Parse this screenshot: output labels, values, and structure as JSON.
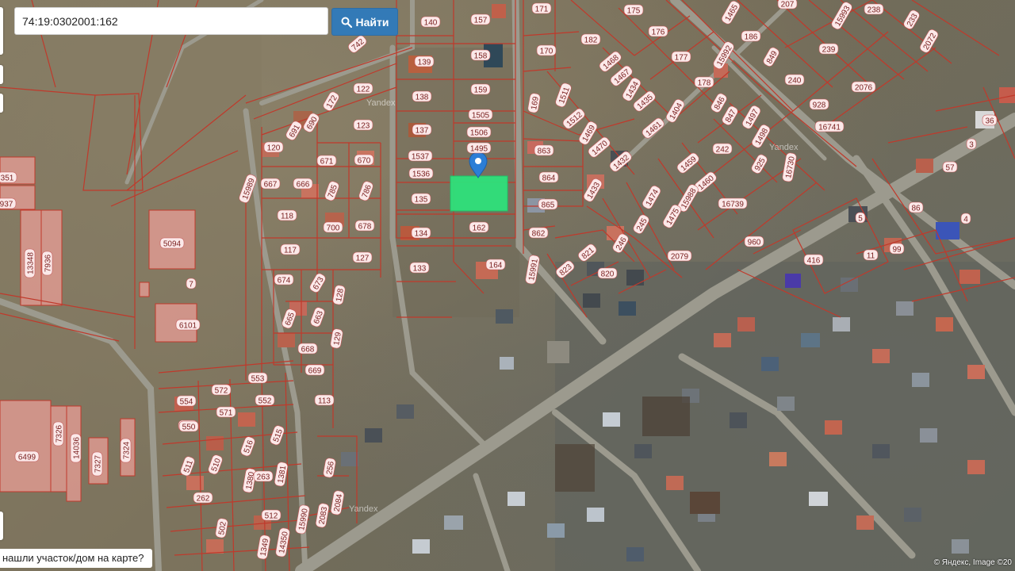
{
  "search": {
    "query": "74:19:0302001:162",
    "button_label": "Найти",
    "button_icon": "search-icon"
  },
  "help": {
    "text": "нашли участок/дом на карте?"
  },
  "copyright": "© Яндекс, Image ©20",
  "watermark": "Yandex",
  "map": {
    "type": "satellite-cadastral",
    "parcel_border_color": "#c0392b",
    "highlight_color": "#2ee07a",
    "marker_color": "#2c7ed6",
    "selected_parcel": "162",
    "parcels": [
      {
        "id": "140",
        "label": "140"
      },
      {
        "id": "157",
        "label": "157"
      },
      {
        "id": "171",
        "label": "171"
      },
      {
        "id": "175",
        "label": "175"
      },
      {
        "id": "1465",
        "label": "1465"
      },
      {
        "id": "207",
        "label": "207"
      },
      {
        "id": "15993",
        "label": "15993"
      },
      {
        "id": "238",
        "label": "238"
      },
      {
        "id": "233",
        "label": "233"
      },
      {
        "id": "742",
        "label": "742"
      },
      {
        "id": "139",
        "label": "139"
      },
      {
        "id": "158",
        "label": "158"
      },
      {
        "id": "170",
        "label": "170"
      },
      {
        "id": "182",
        "label": "182"
      },
      {
        "id": "176",
        "label": "176"
      },
      {
        "id": "186",
        "label": "186"
      },
      {
        "id": "849",
        "label": "849"
      },
      {
        "id": "239",
        "label": "239"
      },
      {
        "id": "2072",
        "label": "2072"
      },
      {
        "id": "15992",
        "label": "15992"
      },
      {
        "id": "122",
        "label": "122"
      },
      {
        "id": "138",
        "label": "138"
      },
      {
        "id": "159",
        "label": "159"
      },
      {
        "id": "1511",
        "label": "1511"
      },
      {
        "id": "1468",
        "label": "1468"
      },
      {
        "id": "177",
        "label": "177"
      },
      {
        "id": "240",
        "label": "240"
      },
      {
        "id": "2076",
        "label": "2076"
      },
      {
        "id": "172",
        "label": "172"
      },
      {
        "id": "1467",
        "label": "1467"
      },
      {
        "id": "1434",
        "label": "1434"
      },
      {
        "id": "178",
        "label": "178"
      },
      {
        "id": "928",
        "label": "928"
      },
      {
        "id": "169",
        "label": "169"
      },
      {
        "id": "1435",
        "label": "1435"
      },
      {
        "id": "846",
        "label": "846"
      },
      {
        "id": "690",
        "label": "690"
      },
      {
        "id": "123",
        "label": "123"
      },
      {
        "id": "137",
        "label": "137"
      },
      {
        "id": "1505",
        "label": "1505"
      },
      {
        "id": "1512",
        "label": "1512"
      },
      {
        "id": "1404",
        "label": "1404"
      },
      {
        "id": "847",
        "label": "847"
      },
      {
        "id": "1497",
        "label": "1497"
      },
      {
        "id": "16741",
        "label": "16741"
      },
      {
        "id": "691",
        "label": "691"
      },
      {
        "id": "1506",
        "label": "1506"
      },
      {
        "id": "1469",
        "label": "1469"
      },
      {
        "id": "1461",
        "label": "1461"
      },
      {
        "id": "1498",
        "label": "1498"
      },
      {
        "id": "120",
        "label": "120"
      },
      {
        "id": "1495",
        "label": "1495"
      },
      {
        "id": "863",
        "label": "863"
      },
      {
        "id": "1470",
        "label": "1470"
      },
      {
        "id": "242",
        "label": "242"
      },
      {
        "id": "671",
        "label": "671"
      },
      {
        "id": "670",
        "label": "670"
      },
      {
        "id": "1537",
        "label": "1537"
      },
      {
        "id": "1432",
        "label": "1432"
      },
      {
        "id": "1459",
        "label": "1459"
      },
      {
        "id": "925",
        "label": "925"
      },
      {
        "id": "16730",
        "label": "16730"
      },
      {
        "id": "667",
        "label": "667"
      },
      {
        "id": "666",
        "label": "666"
      },
      {
        "id": "1536",
        "label": "1536"
      },
      {
        "id": "864",
        "label": "864"
      },
      {
        "id": "1460",
        "label": "1460"
      },
      {
        "id": "15989",
        "label": "15989"
      },
      {
        "id": "785",
        "label": "785"
      },
      {
        "id": "786",
        "label": "786"
      },
      {
        "id": "135",
        "label": "135"
      },
      {
        "id": "1433",
        "label": "1433"
      },
      {
        "id": "1474",
        "label": "1474"
      },
      {
        "id": "15988",
        "label": "15988"
      },
      {
        "id": "16739",
        "label": "16739"
      },
      {
        "id": "865",
        "label": "865"
      },
      {
        "id": "118",
        "label": "118"
      },
      {
        "id": "700",
        "label": "700"
      },
      {
        "id": "678",
        "label": "678"
      },
      {
        "id": "1475",
        "label": "1475"
      },
      {
        "id": "245",
        "label": "245"
      },
      {
        "id": "134",
        "label": "134"
      },
      {
        "id": "162",
        "label": "162"
      },
      {
        "id": "862",
        "label": "862"
      },
      {
        "id": "246",
        "label": "246"
      },
      {
        "id": "960",
        "label": "960"
      },
      {
        "id": "117",
        "label": "117"
      },
      {
        "id": "127",
        "label": "127"
      },
      {
        "id": "821",
        "label": "821"
      },
      {
        "id": "2079",
        "label": "2079"
      },
      {
        "id": "133",
        "label": "133"
      },
      {
        "id": "164",
        "label": "164"
      },
      {
        "id": "15991",
        "label": "15991"
      },
      {
        "id": "823",
        "label": "823"
      },
      {
        "id": "820",
        "label": "820"
      },
      {
        "id": "674",
        "label": "674"
      },
      {
        "id": "673",
        "label": "673"
      },
      {
        "id": "128",
        "label": "128"
      },
      {
        "id": "663",
        "label": "663"
      },
      {
        "id": "665",
        "label": "665"
      },
      {
        "id": "129",
        "label": "129"
      },
      {
        "id": "668",
        "label": "668"
      },
      {
        "id": "669",
        "label": "669"
      },
      {
        "id": "553",
        "label": "553"
      },
      {
        "id": "552",
        "label": "552"
      },
      {
        "id": "113",
        "label": "113"
      },
      {
        "id": "554",
        "label": "554"
      },
      {
        "id": "572",
        "label": "572"
      },
      {
        "id": "551",
        "label": "551"
      },
      {
        "id": "571",
        "label": "571"
      },
      {
        "id": "550",
        "label": "550"
      },
      {
        "id": "515",
        "label": "515"
      },
      {
        "id": "516",
        "label": "516"
      },
      {
        "id": "511",
        "label": "511"
      },
      {
        "id": "510",
        "label": "510"
      },
      {
        "id": "1380",
        "label": "1380"
      },
      {
        "id": "263",
        "label": "263"
      },
      {
        "id": "1381",
        "label": "1381"
      },
      {
        "id": "256",
        "label": "256"
      },
      {
        "id": "262",
        "label": "262"
      },
      {
        "id": "2084",
        "label": "2084"
      },
      {
        "id": "512",
        "label": "512"
      },
      {
        "id": "15990",
        "label": "15990"
      },
      {
        "id": "2083",
        "label": "2083"
      },
      {
        "id": "14350",
        "label": "14350"
      },
      {
        "id": "502",
        "label": "502"
      },
      {
        "id": "1349",
        "label": "1349"
      },
      {
        "id": "5094",
        "label": "5094"
      },
      {
        "id": "7",
        "label": "7"
      },
      {
        "id": "6101",
        "label": "6101"
      },
      {
        "id": "351",
        "label": "351"
      },
      {
        "id": "937",
        "label": "937"
      },
      {
        "id": "13348",
        "label": "13348"
      },
      {
        "id": "7936",
        "label": "7936"
      },
      {
        "id": "6499",
        "label": "6499"
      },
      {
        "id": "7326",
        "label": "7326"
      },
      {
        "id": "14036",
        "label": "14036"
      },
      {
        "id": "7327",
        "label": "7327"
      },
      {
        "id": "7324",
        "label": "7324"
      },
      {
        "id": "416",
        "label": "416"
      },
      {
        "id": "5",
        "label": "5"
      },
      {
        "id": "11",
        "label": "11"
      },
      {
        "id": "99",
        "label": "99"
      },
      {
        "id": "36",
        "label": "36"
      },
      {
        "id": "3",
        "label": "3"
      },
      {
        "id": "57",
        "label": "57"
      },
      {
        "id": "86",
        "label": "86"
      },
      {
        "id": "4",
        "label": "4"
      }
    ]
  }
}
